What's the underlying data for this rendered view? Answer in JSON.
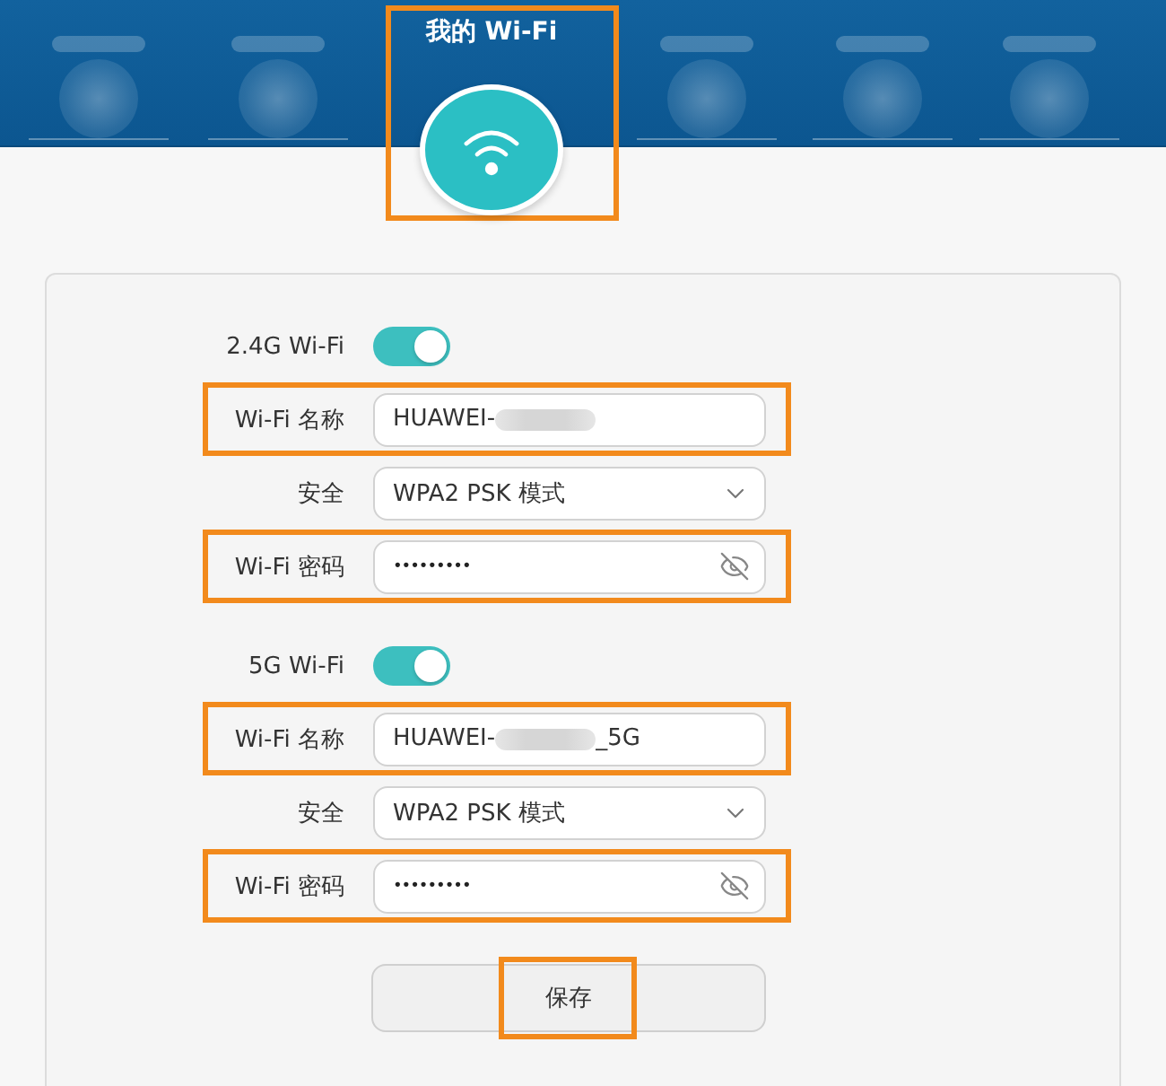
{
  "header": {
    "nav_items": [
      {
        "selected": false
      },
      {
        "selected": false
      },
      {
        "selected": true,
        "label": "我的 Wi-Fi",
        "highlighted": true
      },
      {
        "selected": false
      },
      {
        "selected": false
      },
      {
        "selected": false
      }
    ]
  },
  "bands": [
    {
      "label": "2.4G Wi-Fi",
      "enabled": true,
      "fields": [
        {
          "kind": "text",
          "label": "Wi-Fi 名称",
          "value": "HUAWEI-",
          "redacted": true,
          "highlighted": true
        },
        {
          "kind": "select",
          "label": "安全",
          "value": "WPA2 PSK 模式",
          "highlighted": false
        },
        {
          "kind": "password",
          "label": "Wi-Fi 密码",
          "value": "•••••••••",
          "highlighted": true
        }
      ]
    },
    {
      "label": "5G Wi-Fi",
      "enabled": true,
      "fields": [
        {
          "kind": "text",
          "label": "Wi-Fi 名称",
          "value": "HUAWEI-",
          "redacted": true,
          "suffix": "_5G",
          "highlighted": true
        },
        {
          "kind": "select",
          "label": "安全",
          "value": "WPA2 PSK 模式",
          "highlighted": false
        },
        {
          "kind": "password",
          "label": "Wi-Fi 密码",
          "value": "•••••••••",
          "highlighted": true
        }
      ]
    }
  ],
  "save_button": {
    "label": "保存",
    "highlighted": true
  }
}
